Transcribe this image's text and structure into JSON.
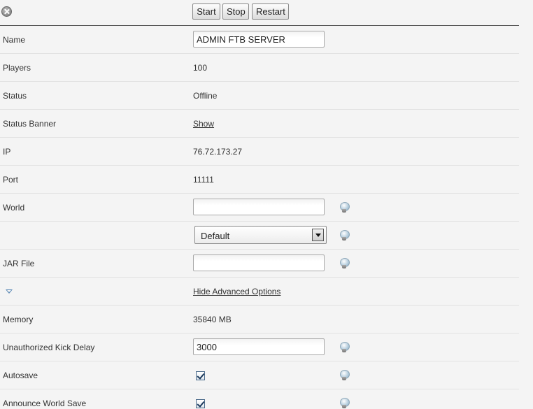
{
  "toolbar": {
    "close_icon": "close-icon",
    "start_label": "Start",
    "stop_label": "Stop",
    "restart_label": "Restart"
  },
  "rows": {
    "name": {
      "label": "Name",
      "value": "ADMIN FTB SERVER"
    },
    "players": {
      "label": "Players",
      "value": "100"
    },
    "status": {
      "label": "Status",
      "value": "Offline"
    },
    "status_banner": {
      "label": "Status Banner",
      "link": "Show"
    },
    "ip": {
      "label": "IP",
      "value": "76.72.173.27"
    },
    "port": {
      "label": "Port",
      "value": "11111"
    },
    "world": {
      "label": "World",
      "value": ""
    },
    "world_template": {
      "selected": "Default"
    },
    "jar_file": {
      "label": "JAR File",
      "value": ""
    },
    "advanced": {
      "link": "Hide Advanced Options"
    },
    "memory": {
      "label": "Memory",
      "value": "35840 MB"
    },
    "kick_delay": {
      "label": "Unauthorized Kick Delay",
      "value": "3000"
    },
    "autosave": {
      "label": "Autosave",
      "checked": true
    },
    "announce_save": {
      "label": "Announce World Save",
      "checked": true
    }
  },
  "icons": {
    "help": "lightbulb-help-icon",
    "toggle": "triangle-down-icon"
  },
  "colors": {
    "background": "#f4f4f4",
    "divider": "#e2e2e2",
    "toggle_accent": "#5a88b5"
  }
}
